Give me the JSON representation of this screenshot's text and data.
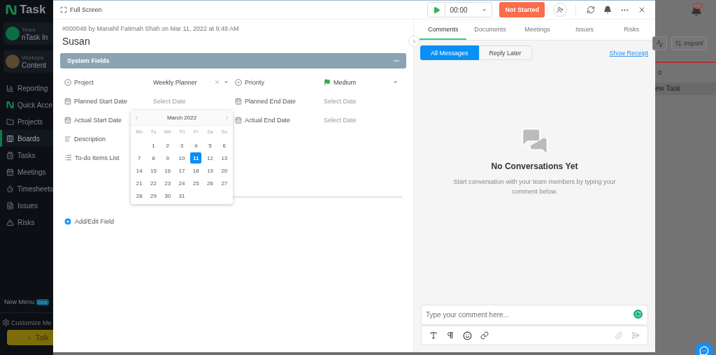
{
  "sidebar": {
    "logo": "Task",
    "team": {
      "label": "Team",
      "name": "nTask In"
    },
    "workspace": {
      "label": "Workspa",
      "name": "Content"
    },
    "items": [
      {
        "label": "Reporting",
        "selected": false
      },
      {
        "label": "Quick Acce",
        "selected": false
      },
      {
        "label": "Projects",
        "selected": false
      },
      {
        "label": "Boards",
        "selected": true
      },
      {
        "label": "Tasks",
        "selected": false
      },
      {
        "label": "Meetings",
        "selected": false
      },
      {
        "label": "Timesheets",
        "selected": false
      },
      {
        "label": "Issues",
        "selected": false
      },
      {
        "label": "Risks",
        "selected": false
      }
    ],
    "new_menu": {
      "label": "New Menu",
      "badge": "beta"
    },
    "customize": "Customize Me",
    "talk_button": "Talk"
  },
  "modal": {
    "header": {
      "fullscreen": "Full Screen",
      "timer": "00:00",
      "status": "Not Started"
    },
    "meta": "#000048 by Manahil Fatimah Shah on Mar 11, 2022 at 9:48 AM",
    "title": "Susan",
    "section": {
      "title": "System Fields",
      "expanded": true
    },
    "rows": [
      [
        {
          "kind": "select",
          "label": "Project",
          "value": "Weekly Planner",
          "clearable": true,
          "flag": false
        },
        {
          "kind": "select",
          "label": "Priority",
          "value": "Medium",
          "clearable": false,
          "flag": true
        }
      ],
      [
        {
          "kind": "date",
          "label": "Planned Start Date",
          "placeholder": "Select Date"
        },
        {
          "kind": "date",
          "label": "Planned End Date",
          "placeholder": "Select Date"
        }
      ],
      [
        {
          "kind": "date",
          "label": "Actual Start Date"
        },
        {
          "kind": "date",
          "label": "Actual End Date",
          "placeholder": "Select Date"
        }
      ],
      [
        {
          "kind": "text",
          "label": "Description"
        }
      ],
      [
        {
          "kind": "list",
          "label": "To-do Items List"
        }
      ]
    ],
    "calendar": {
      "month": "March 2022",
      "weekdays": [
        "Mo",
        "Tu",
        "We",
        "Th",
        "Fr",
        "Sa",
        "Su"
      ],
      "weeks": [
        [
          {
            "d": "1",
            "selected": false
          },
          {
            "d": "2",
            "selected": false
          },
          {
            "d": "3",
            "selected": false
          },
          {
            "d": "4",
            "selected": false
          },
          {
            "d": "5",
            "selected": false
          },
          {
            "d": "6",
            "selected": false
          }
        ],
        [
          {
            "d": "7",
            "selected": false
          },
          {
            "d": "8",
            "selected": false
          },
          {
            "d": "9",
            "selected": false
          },
          {
            "d": "10",
            "selected": false
          },
          {
            "d": "11",
            "selected": true
          },
          {
            "d": "12",
            "selected": false
          },
          {
            "d": "13",
            "selected": false
          }
        ],
        [
          {
            "d": "14",
            "selected": false
          },
          {
            "d": "15",
            "selected": false
          },
          {
            "d": "16",
            "selected": false
          },
          {
            "d": "17",
            "selected": false
          },
          {
            "d": "18",
            "selected": false
          },
          {
            "d": "19",
            "selected": false
          },
          {
            "d": "20",
            "selected": false
          }
        ],
        [
          {
            "d": "21",
            "selected": false
          },
          {
            "d": "22",
            "selected": false
          },
          {
            "d": "23",
            "selected": false
          },
          {
            "d": "24",
            "selected": false
          },
          {
            "d": "25",
            "selected": false
          },
          {
            "d": "26",
            "selected": false
          },
          {
            "d": "27",
            "selected": false
          }
        ],
        [
          {
            "d": "28",
            "selected": false
          },
          {
            "d": "29",
            "selected": false
          },
          {
            "d": "30",
            "selected": false
          },
          {
            "d": "31",
            "selected": false
          }
        ]
      ]
    },
    "add_field": "Add/Edit Field",
    "tabs": [
      {
        "label": "Comments",
        "selected": true
      },
      {
        "label": "Documents",
        "selected": false
      },
      {
        "label": "Meetings",
        "selected": false
      },
      {
        "label": "Issues",
        "selected": false
      },
      {
        "label": "Risks",
        "selected": false
      }
    ],
    "filters": [
      {
        "label": "All Messages",
        "selected": true
      },
      {
        "label": "Reply Later",
        "selected": false
      }
    ],
    "show_receipt": "Show Receipt",
    "empty": {
      "title": "No Conversations Yet",
      "text": "Start conversation with your team members by typing your comment below."
    },
    "comment": {
      "placeholder": "Type your comment here..."
    }
  },
  "background": {
    "notifications": "10",
    "import_button": "Import/",
    "count": "0",
    "row": "ew Task"
  }
}
